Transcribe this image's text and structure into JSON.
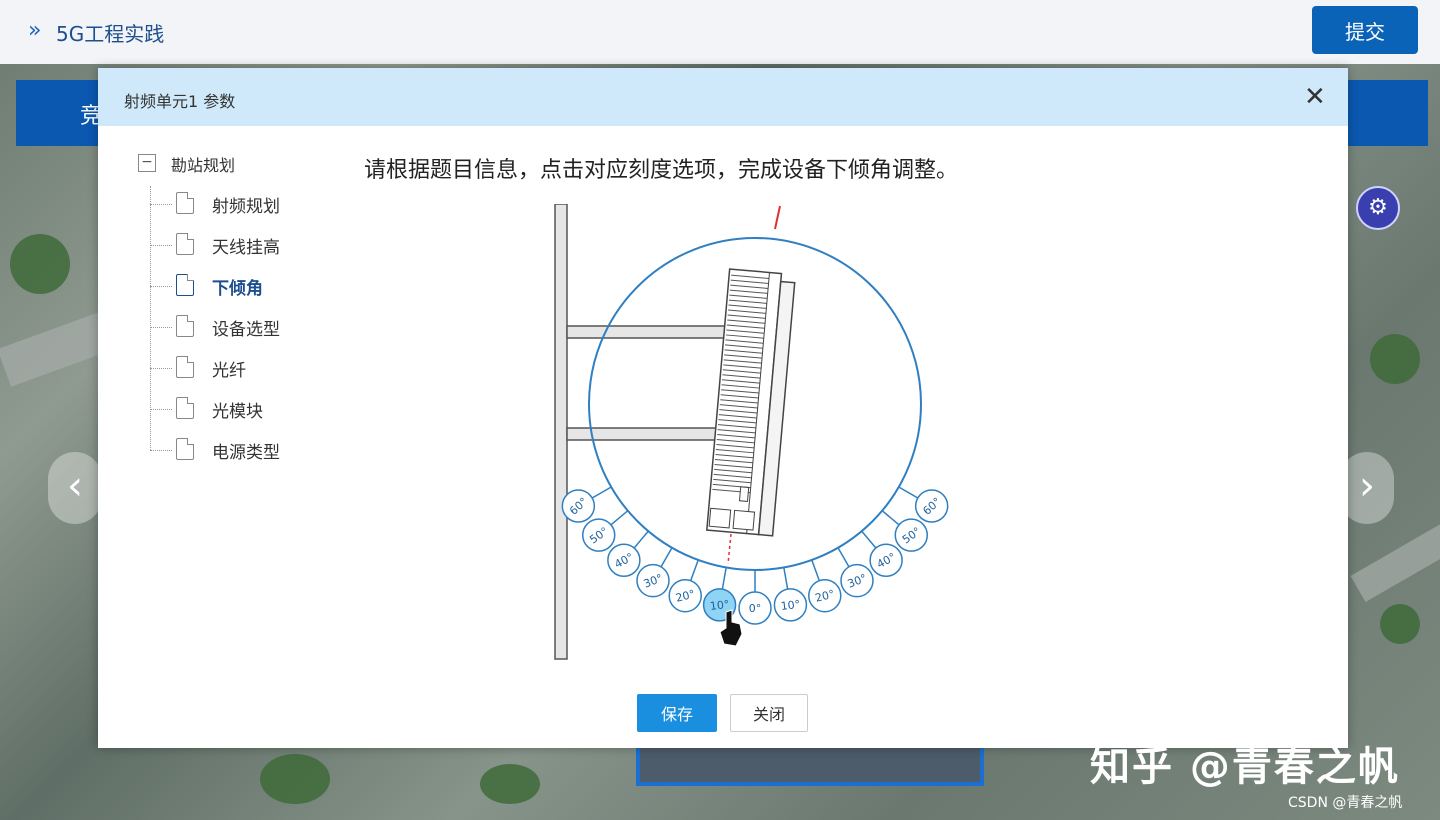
{
  "app": {
    "title": "5G工程实践",
    "submit_label": "提交",
    "banner_text": "竞"
  },
  "dialog": {
    "title": "射频单元1 参数",
    "close_glyph": "✕",
    "instruction": "请根据题目信息，点击对应刻度选项，完成设备下倾角调整。",
    "save_label": "保存",
    "close_label": "关闭"
  },
  "tree": {
    "root": "勘站规划",
    "items": [
      {
        "label": "射频规划",
        "active": false
      },
      {
        "label": "天线挂高",
        "active": false
      },
      {
        "label": "下倾角",
        "active": true
      },
      {
        "label": "设备选型",
        "active": false
      },
      {
        "label": "光纤",
        "active": false
      },
      {
        "label": "光模块",
        "active": false
      },
      {
        "label": "电源类型",
        "active": false
      }
    ]
  },
  "tilt_options": [
    {
      "label": "60°",
      "side": "left"
    },
    {
      "label": "50°",
      "side": "left"
    },
    {
      "label": "40°",
      "side": "left"
    },
    {
      "label": "30°",
      "side": "left"
    },
    {
      "label": "20°",
      "side": "left"
    },
    {
      "label": "10°",
      "side": "left",
      "selected": true
    },
    {
      "label": "0°",
      "side": "center"
    },
    {
      "label": "10°",
      "side": "right"
    },
    {
      "label": "20°",
      "side": "right"
    },
    {
      "label": "30°",
      "side": "right"
    },
    {
      "label": "40°",
      "side": "right"
    },
    {
      "label": "50°",
      "side": "right"
    },
    {
      "label": "60°",
      "side": "right"
    }
  ],
  "colors": {
    "accent": "#1a8fe0",
    "primary": "#0b63b8",
    "dial": "#2f7fc1",
    "selected_option": "#8fd3f5"
  },
  "icons": {
    "nav_prev": "‹",
    "nav_next": "›",
    "settings": "⚙",
    "breadcrumb": "»"
  },
  "watermark": {
    "text": "知乎 @青春之帆",
    "csdn": "CSDN @青春之帆"
  }
}
